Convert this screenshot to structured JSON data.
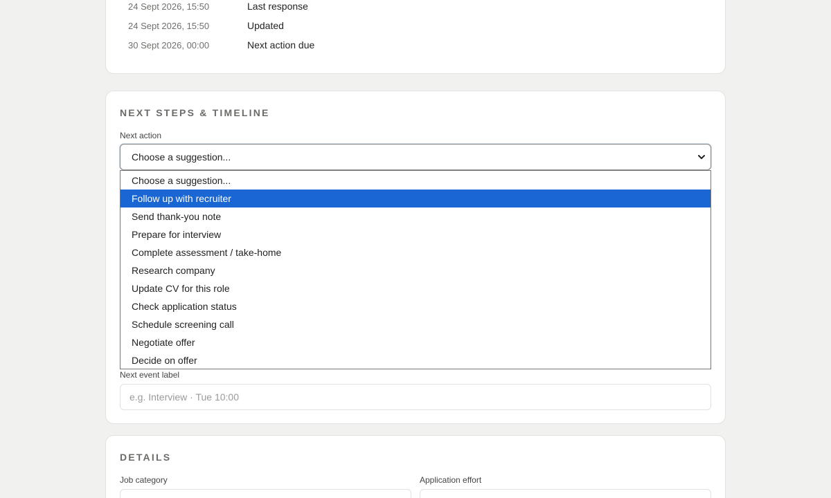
{
  "dates": [
    {
      "date": "24 Sept 2026, 15:50",
      "label": "Last response"
    },
    {
      "date": "24 Sept 2026, 15:50",
      "label": "Updated"
    },
    {
      "date": "30 Sept 2026, 00:00",
      "label": "Next action due"
    }
  ],
  "next_steps": {
    "title": "NEXT STEPS & TIMELINE",
    "next_action_label": "Next action",
    "select_value": "Choose a suggestion...",
    "options": [
      "Choose a suggestion...",
      "Follow up with recruiter",
      "Send thank-you note",
      "Prepare for interview",
      "Complete assessment / take-home",
      "Research company",
      "Update CV for this role",
      "Check application status",
      "Schedule screening call",
      "Negotiate offer",
      "Decide on offer"
    ],
    "highlighted_option": "Follow up with recruiter",
    "next_event_label": "Next event label",
    "next_event_placeholder": "e.g. Interview · Tue 10:00"
  },
  "details": {
    "title": "DETAILS",
    "job_category_label": "Job category",
    "application_effort_label": "Application effort"
  },
  "colors": {
    "highlight": "#1a66d2",
    "background": "#f1f1f0"
  },
  "icons": {
    "select_chevron": "chevron-down-icon"
  }
}
